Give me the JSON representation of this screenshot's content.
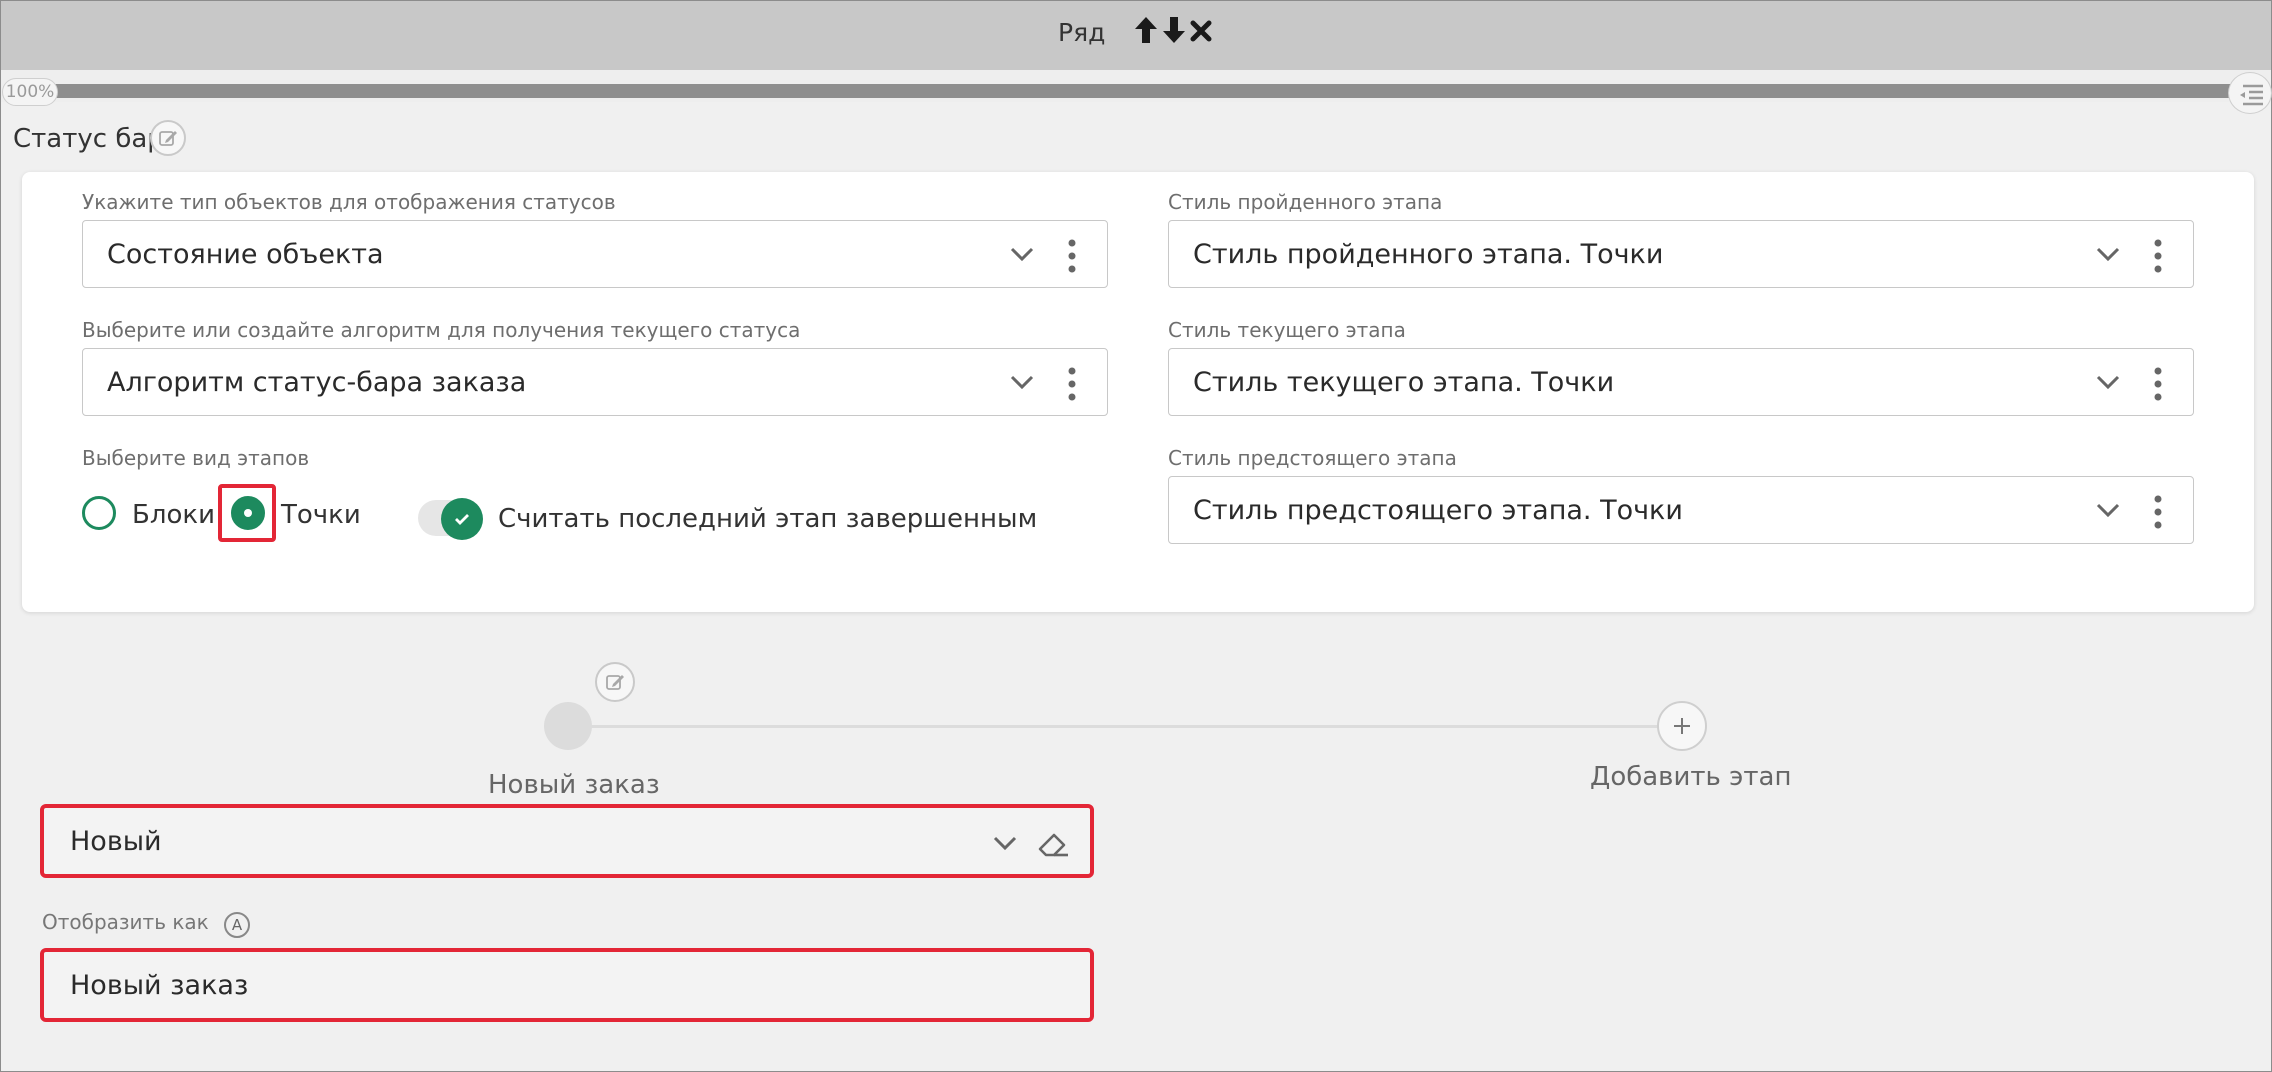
{
  "header": {
    "title": "Ряд"
  },
  "progress": {
    "label": "100%",
    "value_percent": 100
  },
  "section": {
    "title": "Статус бар"
  },
  "form": {
    "object_type": {
      "label": "Укажите тип объектов для отображения статусов",
      "value": "Состояние объекта"
    },
    "algorithm": {
      "label": "Выберите или создайте алгоритм для получения текущего статуса",
      "value": "Алгоритм статус-бара заказа"
    },
    "stage_view": {
      "label": "Выберите вид этапов",
      "options": [
        {
          "label": "Блоки",
          "checked": false
        },
        {
          "label": "Точки",
          "checked": true
        }
      ]
    },
    "last_stage_toggle": {
      "label": "Считать последний этап завершенным",
      "on": true
    },
    "passed_style": {
      "label": "Стиль пройденного этапа",
      "value": "Стиль пройденного этапа. Точки"
    },
    "current_style": {
      "label": "Стиль текущего этапа",
      "value": "Стиль текущего этапа. Точки"
    },
    "upcoming_style": {
      "label": "Стиль предстоящего этапа",
      "value": "Стиль предстоящего этапа. Точки"
    }
  },
  "stages": {
    "items": [
      {
        "label": "Новый заказ"
      }
    ],
    "add_label": "Добавить этап"
  },
  "stage_editor": {
    "status_value": "Новый",
    "display_as_label": "Отобразить как",
    "display_as_badge": "A",
    "display_as_value": "Новый заказ"
  },
  "colors": {
    "accent": "#1d8a5e",
    "highlight": "#e32636",
    "header_bg": "#c8c8c8"
  }
}
